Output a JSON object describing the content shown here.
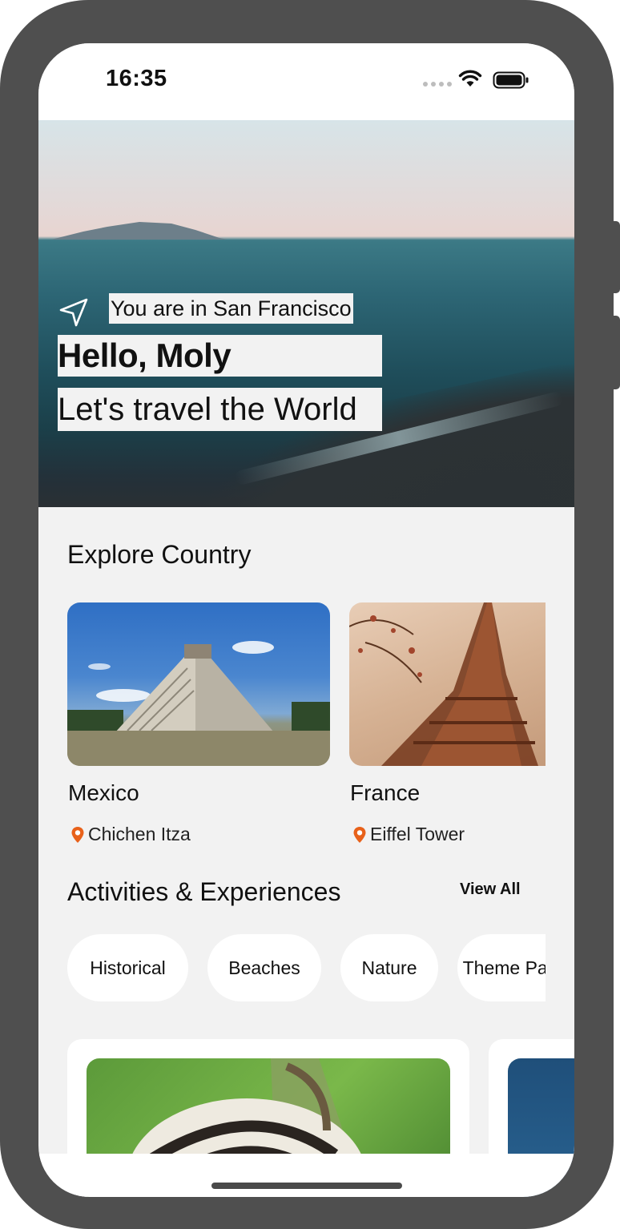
{
  "status": {
    "time": "16:35"
  },
  "hero": {
    "location": "You are in San Francisco",
    "greeting": "Hello, Moly",
    "tagline": "Let's travel the World"
  },
  "explore": {
    "title": "Explore Country",
    "countries": [
      {
        "name": "Mexico",
        "place": "Chichen Itza"
      },
      {
        "name": "France",
        "place": "Eiffel Tower"
      }
    ]
  },
  "activities": {
    "title": "Activities & Experiences",
    "view_all": "View All",
    "chips": [
      "Historical",
      "Beaches",
      "Nature",
      "Theme Parks"
    ]
  },
  "colors": {
    "pin": "#e8611a",
    "background": "#f2f2f2",
    "frame": "#4f4f4f"
  },
  "icons": [
    "navigation-arrow-icon",
    "location-pin-icon",
    "wifi-icon",
    "battery-icon",
    "signal-icon"
  ]
}
